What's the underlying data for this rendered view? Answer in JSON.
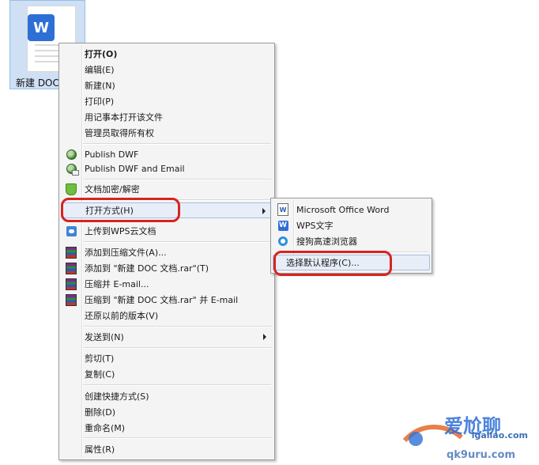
{
  "file": {
    "label": "新建 DOC",
    "icon": "wps-document-icon",
    "badge": "W"
  },
  "context_menu": {
    "items": [
      {
        "label": "打开(O)",
        "bold": true
      },
      {
        "label": "编辑(E)"
      },
      {
        "label": "新建(N)"
      },
      {
        "label": "打印(P)"
      },
      {
        "label": "用记事本打开该文件"
      },
      {
        "label": "管理员取得所有权"
      },
      {
        "label": "Publish DWF",
        "icon": "dwf-globe-icon"
      },
      {
        "label": "Publish DWF and Email",
        "icon": "dwf-globe-mail-icon"
      },
      {
        "label": "文档加密/解密",
        "icon": "shield-icon"
      },
      {
        "label": "打开方式(H)",
        "submenu": true
      },
      {
        "label": "上传到WPS云文档",
        "icon": "wps-cloud-icon"
      },
      {
        "label": "添加到压缩文件(A)...",
        "icon": "winrar-icon"
      },
      {
        "label": "添加到 \"新建 DOC 文档.rar\"(T)",
        "icon": "winrar-icon"
      },
      {
        "label": "压缩并 E-mail...",
        "icon": "winrar-icon"
      },
      {
        "label": "压缩到 \"新建 DOC 文档.rar\" 并 E-mail",
        "icon": "winrar-icon"
      },
      {
        "label": "还原以前的版本(V)"
      },
      {
        "label": "发送到(N)",
        "submenu": true
      },
      {
        "label": "剪切(T)"
      },
      {
        "label": "复制(C)"
      },
      {
        "label": "创建快捷方式(S)"
      },
      {
        "label": "删除(D)"
      },
      {
        "label": "重命名(M)"
      },
      {
        "label": "属性(R)"
      }
    ]
  },
  "open_with_submenu": {
    "items": [
      {
        "label": "Microsoft Office Word",
        "icon": "ms-word-icon",
        "glyph": "W"
      },
      {
        "label": "WPS文字",
        "icon": "wps-writer-icon",
        "glyph": "W"
      },
      {
        "label": "搜狗高速浏览器",
        "icon": "sogou-browser-icon"
      },
      {
        "label": "选择默认程序(C)..."
      }
    ]
  },
  "watermark": {
    "brand": "爱尬聊",
    "site": "igaliao.com",
    "url": "qk9uru.com"
  },
  "colors": {
    "highlight_ring": "#d8231f",
    "menu_bg": "#f4f4f4",
    "hover": "#e8eef8"
  }
}
